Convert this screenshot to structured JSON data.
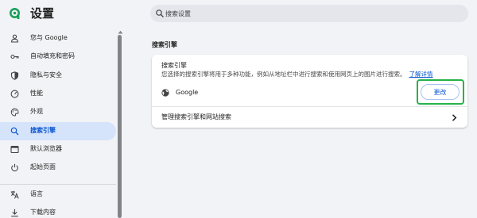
{
  "app": {
    "title": "设置",
    "logo_icon": "browser-logo-icon",
    "accent_color": "#19a05a"
  },
  "search": {
    "placeholder": "搜索设置",
    "icon": "search-icon"
  },
  "sidebar": {
    "items": [
      {
        "label": "您与 Google",
        "icon": "person-icon",
        "active": false
      },
      {
        "label": "自动填充和密码",
        "icon": "key-icon",
        "active": false
      },
      {
        "label": "隐私与安全",
        "icon": "shield-icon",
        "active": false
      },
      {
        "label": "性能",
        "icon": "gauge-icon",
        "active": false
      },
      {
        "label": "外观",
        "icon": "palette-icon",
        "active": false
      },
      {
        "label": "搜索引擎",
        "icon": "search-icon",
        "active": true
      },
      {
        "label": "默认浏览器",
        "icon": "browser-window-icon",
        "active": false
      },
      {
        "label": "起始页面",
        "icon": "power-icon",
        "active": false
      },
      {
        "label": "语言",
        "icon": "translate-icon",
        "active": false
      },
      {
        "label": "下载内容",
        "icon": "download-icon",
        "active": false
      }
    ],
    "active_color": "#d5e3fb"
  },
  "main": {
    "section_title": "搜索引擎",
    "card": {
      "heading": "搜索引擎",
      "description": "您选择的搜索引擎将用于多种功能，例如从地址栏中进行搜索和使用网页上的图片进行搜索。",
      "learn_more": "了解详情",
      "engine_name": "Google",
      "engine_icon": "globe-icon",
      "change_label": "更改",
      "highlight_color": "#25b34a",
      "manage_label": "管理搜索引擎和网站搜索",
      "manage_icon": "chevron-right-icon"
    }
  }
}
